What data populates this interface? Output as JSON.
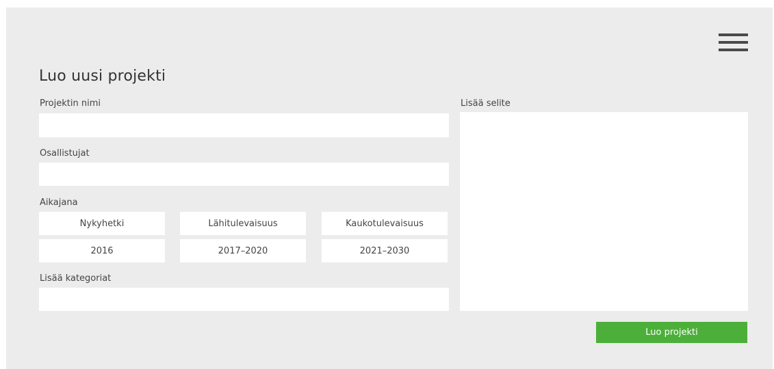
{
  "form": {
    "title": "Luo uusi projekti",
    "project_name_label": "Projektin nimi",
    "project_name_value": "",
    "participants_label": "Osallistujat",
    "participants_value": "",
    "timeline_label": "Aikajana",
    "timeline_options": [
      {
        "label": "Nykyhetki",
        "period": "2016"
      },
      {
        "label": "Lähitulevaisuus",
        "period": "2017–2020"
      },
      {
        "label": "Kaukotulevaisuus",
        "period": "2021–2030"
      }
    ],
    "categories_label": "Lisää kategoriat",
    "categories_value": "",
    "description_label": "Lisää selite",
    "description_value": "",
    "submit_label": "Luo projekti"
  },
  "header": {
    "menu_icon": "hamburger-menu-icon"
  },
  "colors": {
    "background": "#ececec",
    "field": "#ffffff",
    "accent": "#4caf3a"
  }
}
